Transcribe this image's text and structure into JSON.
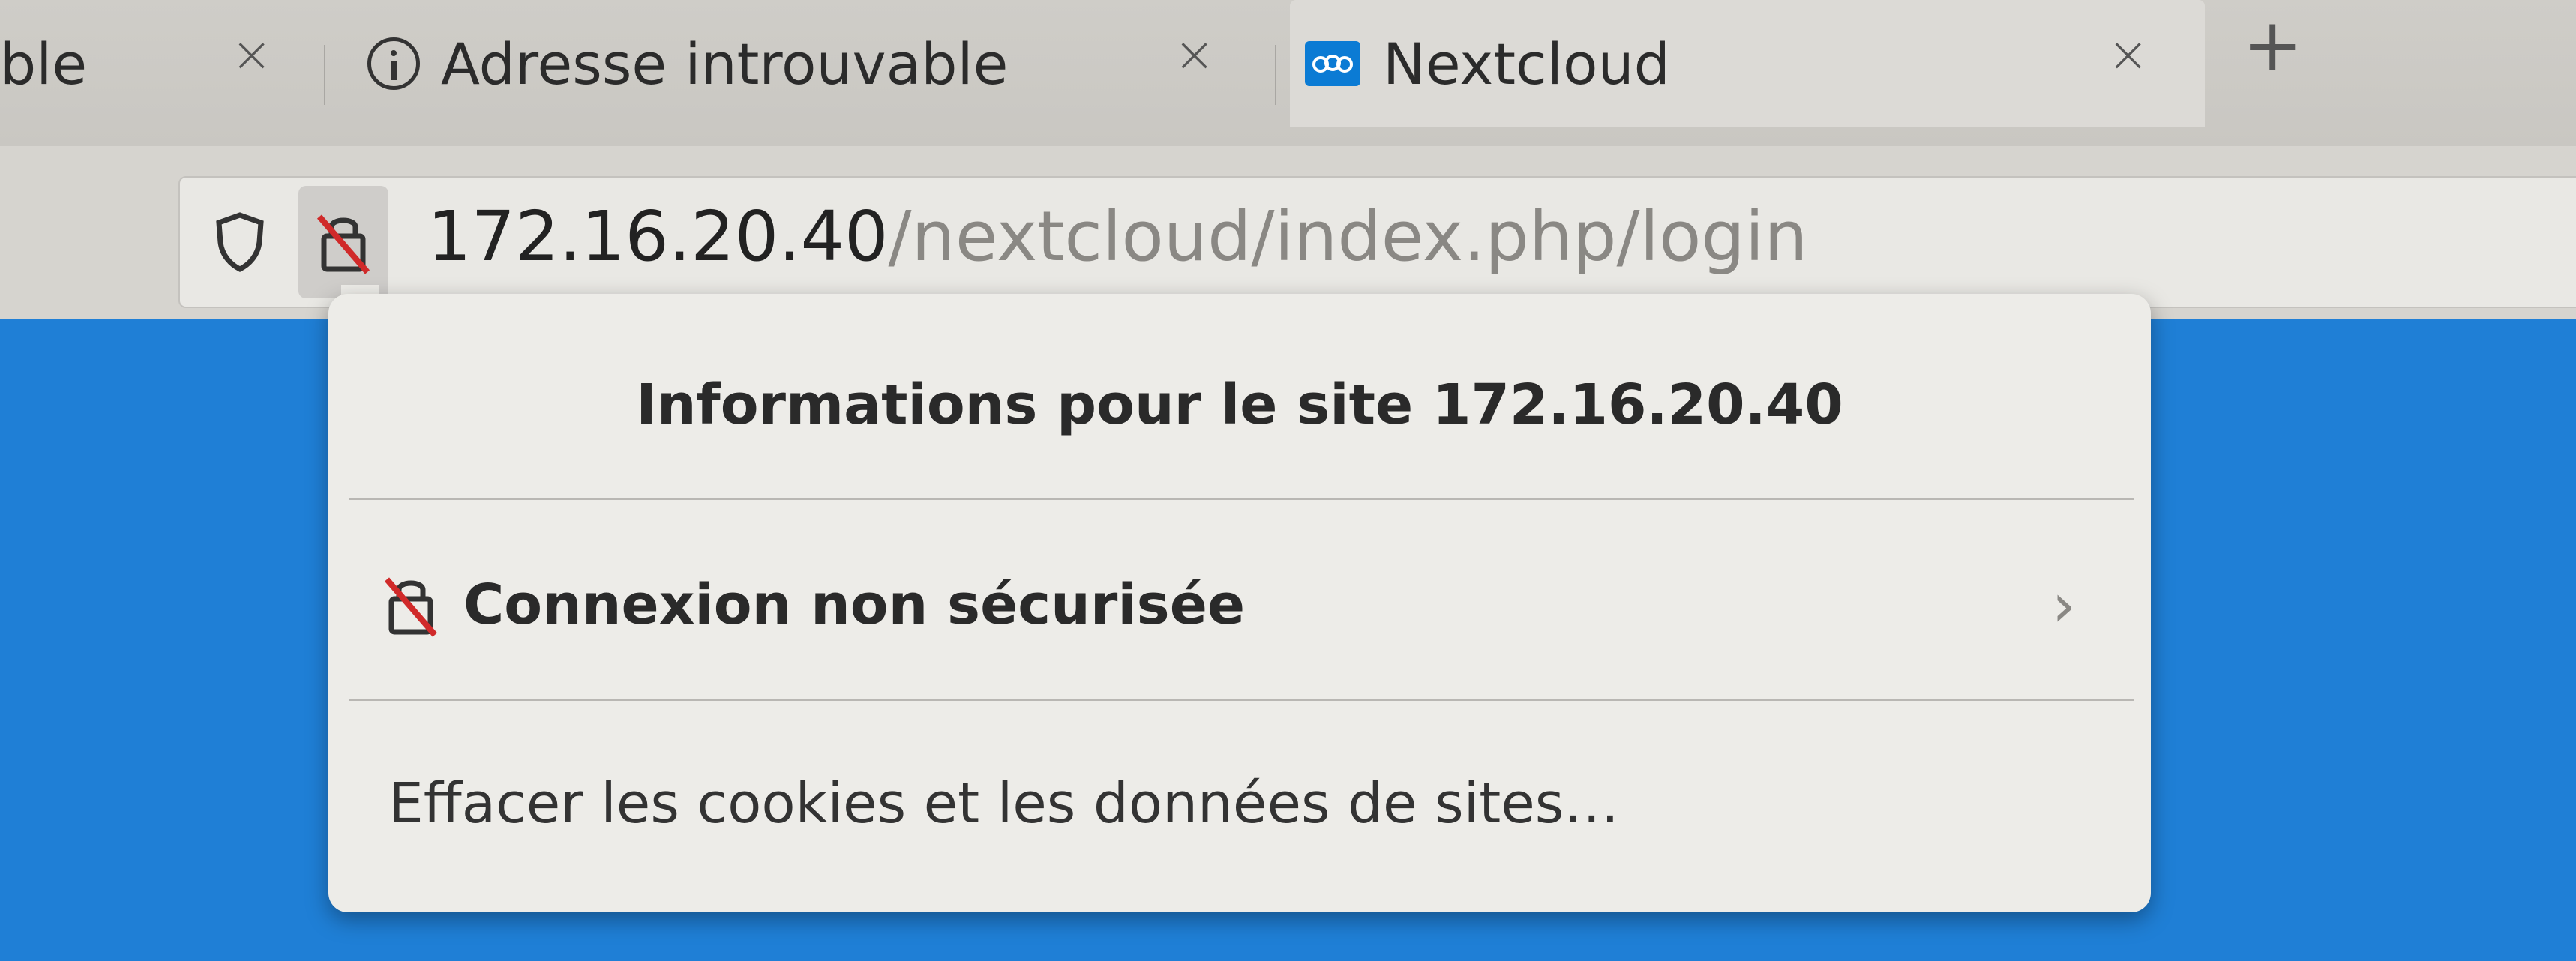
{
  "tabs": [
    {
      "title": "ble",
      "close": "×"
    },
    {
      "title": "Adresse introuvable",
      "close": "×"
    },
    {
      "title": "Nextcloud",
      "close": "×",
      "active": true
    }
  ],
  "new_tab_label": "+",
  "url": {
    "host": "172.16.20.40",
    "path": "/nextcloud/index.php/login"
  },
  "popup": {
    "title": "Informations pour le site 172.16.20.40",
    "connection_label": "Connexion non sécurisée",
    "chevron": "›",
    "clear_label": "Effacer les cookies et les données de sites…"
  },
  "colors": {
    "page_bg": "#1f7fd6",
    "insecure_red": "#d02a2a",
    "nextcloud_blue": "#0b7bd4"
  }
}
